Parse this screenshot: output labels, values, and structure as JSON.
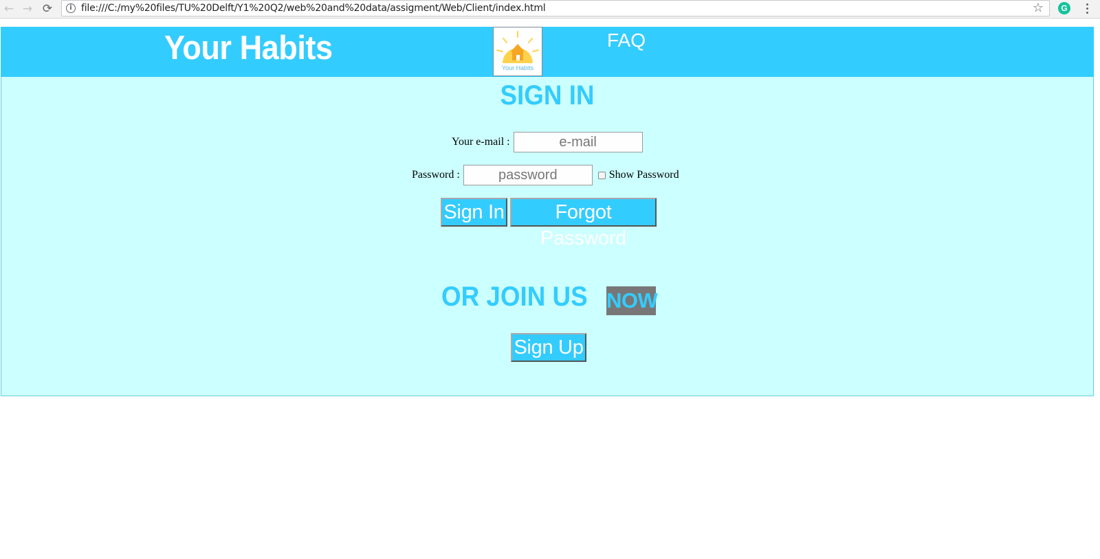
{
  "browser": {
    "back_icon": "←",
    "forward_icon": "→",
    "reload_icon": "⟳",
    "info_icon": "i",
    "url": "file:///C:/my%20files/TU%20Delft/Y1%20Q2/web%20and%20data/assigment/Web/Client/index.html",
    "star_icon": "☆",
    "extension_icon": "G"
  },
  "header": {
    "title": "Your Habits",
    "logo_text": "Your Habits",
    "faq_label": "FAQ"
  },
  "signin": {
    "title": "SIGN IN",
    "email_label": "Your e-mail :",
    "email_placeholder": "e-mail",
    "password_label": "Password :",
    "password_placeholder": "password",
    "show_password_label": "Show Password",
    "signin_button": "Sign In",
    "forgot_button": "Forgot Password"
  },
  "join": {
    "title": "OR JOIN US",
    "badge": "NOW",
    "signup_button": "Sign Up"
  },
  "colors": {
    "header_bg": "#33ccff",
    "content_bg": "#ccffff",
    "accent": "#33ccff",
    "badge_bg": "#777777",
    "logo_sun": "#ffd24d"
  }
}
